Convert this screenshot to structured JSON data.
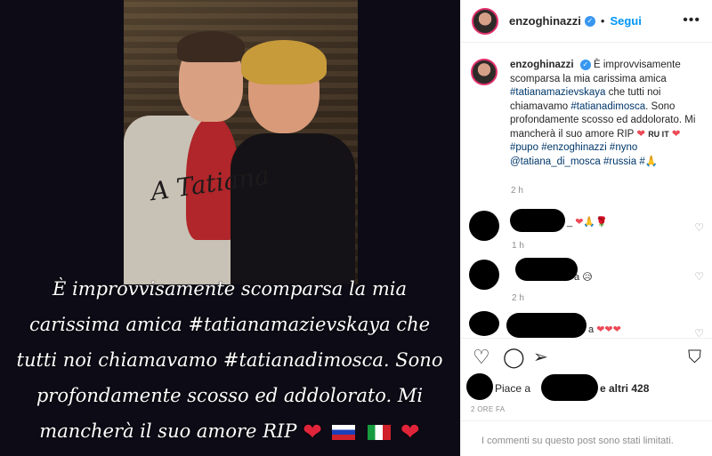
{
  "post": {
    "overlay_caption": "È improvvisamente scomparsa la mia carissima amica #tatianamazievskaya che tutti noi chiamavamo #tatianadimosca. Sono profondamente scosso ed addolorato. Mi mancherà il suo amore RIP",
    "autograph": "A Tatiana"
  },
  "header": {
    "username": "enzoghinazzi",
    "follow_label": "Segui",
    "more_icon": "more-horizontal-icon"
  },
  "caption": {
    "username": "enzoghinazzi",
    "text_1": "È improvvisamente scomparsa la mia carissima amica",
    "tag_1": "#tatianamazievskaya",
    "text_2": "che tutti noi chiamavamo",
    "tag_2": "#tatianadimosca",
    "text_3": ". Sono profondamente scosso ed addolorato. Mi mancherà il suo amore RIP",
    "flags_label": "RU IT",
    "tag_3": "#pupo",
    "tag_4": "#enzoghinazzi",
    "tag_5": "#nyno",
    "tag_6": "@tatiana_di_mosca",
    "tag_7": "#russia",
    "tag_8": "#",
    "time": "2 h"
  },
  "comments": [
    {
      "suffix": "_",
      "emojis": "❤🙏🌹",
      "time": "1 h"
    },
    {
      "suffix": "a",
      "emojis": "😥",
      "time": "2 h"
    },
    {
      "suffix": "a",
      "emojis": "❤❤❤",
      "time": ""
    }
  ],
  "likes": {
    "prefix": "Piace a",
    "others": "e altri 428"
  },
  "posted_ago": "2 ORE FA",
  "comments_limited": "I commenti su questo post sono stati limitati.",
  "colors": {
    "link": "#00376b",
    "follow": "#0095f6",
    "heart": "#ed4956",
    "verified": "#3897f0"
  }
}
